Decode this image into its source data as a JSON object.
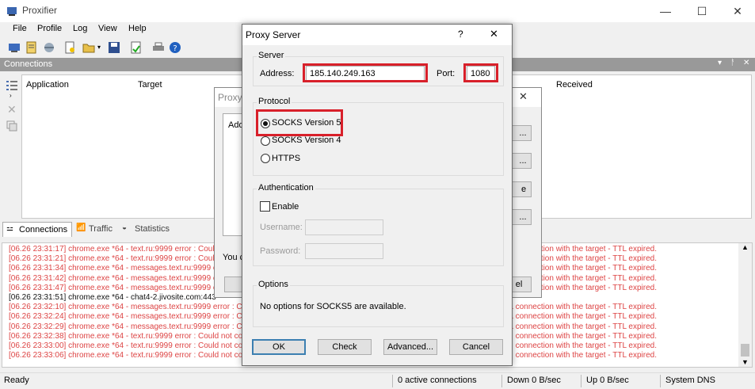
{
  "window": {
    "title": "Proxifier",
    "min": "—",
    "max": "☐",
    "close": "✕"
  },
  "menu": [
    "File",
    "Profile",
    "Log",
    "View",
    "Help"
  ],
  "connections": {
    "header": "Connections",
    "columns": [
      "Application",
      "Target",
      "Received"
    ]
  },
  "tabs": [
    "Connections",
    "Traffic",
    "Statistics"
  ],
  "log": [
    {
      "text": "[06.26 23:31:17] chrome.exe *64 - text.ru:9999 error : Coul",
      "tail": "connection with the target - TTL expired.",
      "black": false
    },
    {
      "text": "[06.26 23:31:21] chrome.exe *64 - text.ru:9999 error : Coul",
      "tail": "connection with the target - TTL expired.",
      "black": false
    },
    {
      "text": "[06.26 23:31:34] chrome.exe *64 - messages.text.ru:9999 e",
      "tail": "a connection with the target - TTL expired.",
      "black": false
    },
    {
      "text": "[06.26 23:31:42] chrome.exe *64 - messages.text.ru:9999 e",
      "tail": "a connection with the target - TTL expired.",
      "black": false
    },
    {
      "text": "[06.26 23:31:47] chrome.exe *64 - messages.text.ru:9999 e",
      "tail": "a connection with the target - TTL expired.",
      "black": false
    },
    {
      "text": "[06.26 23:31:51] chrome.exe *64 - chat4-2.jivosite.com:443",
      "tail": "",
      "black": true
    },
    {
      "text": "[06.26 23:32:10] chrome.exe *64 - messages.text.ru:9999 error : Cou",
      "tail": "establish a connection with the target - TTL expired.",
      "black": false
    },
    {
      "text": "[06.26 23:32:24] chrome.exe *64 - messages.text.ru:9999 error : Cou",
      "tail": "establish a connection with the target - TTL expired.",
      "black": false
    },
    {
      "text": "[06.26 23:32:29] chrome.exe *64 - messages.text.ru:9999 error : Cou",
      "tail": "establish a connection with the target - TTL expired.",
      "black": false
    },
    {
      "text": "[06.26 23:32:38] chrome.exe *64 - text.ru:9999 error : Could not co",
      "tail": "connection with the target - TTL expired.",
      "black": false
    },
    {
      "text": "[06.26 23:33:00] chrome.exe *64 - text.ru:9999 error : Could not co",
      "tail": "connection with the target - TTL expired.",
      "black": false
    },
    {
      "text": "[06.26 23:33:06] chrome.exe *64 - text.ru:9999 error : Could not co",
      "tail": "connection with the target - TTL expired.",
      "black": false
    }
  ],
  "status": {
    "ready": "Ready",
    "active": "0 active connections",
    "down": "Down 0 B/sec",
    "up": "Up 0 B/sec",
    "dns": "System DNS"
  },
  "bg_dialog": {
    "title": "Proxy S",
    "add": "Add",
    "you": "You c",
    "btn_dots": "...",
    "btn_e": "e",
    "btn_l": "el"
  },
  "dialog": {
    "title": "Proxy Server",
    "help": "?",
    "close": "✕",
    "server": {
      "label": "Server",
      "address_label": "Address:",
      "address": "185.140.249.163",
      "port_label": "Port:",
      "port": "1080"
    },
    "protocol": {
      "label": "Protocol",
      "options": [
        "SOCKS Version 5",
        "SOCKS Version 4",
        "HTTPS"
      ],
      "selected": 0
    },
    "auth": {
      "label": "Authentication",
      "enable": "Enable",
      "username_label": "Username:",
      "password_label": "Password:"
    },
    "options": {
      "label": "Options",
      "text": "No options for SOCKS5 are available."
    },
    "buttons": {
      "ok": "OK",
      "check": "Check",
      "advanced": "Advanced...",
      "cancel": "Cancel"
    }
  },
  "colors": {
    "highlight": "#d8202a",
    "log_error": "#dd4444",
    "header_bg": "#999999"
  }
}
